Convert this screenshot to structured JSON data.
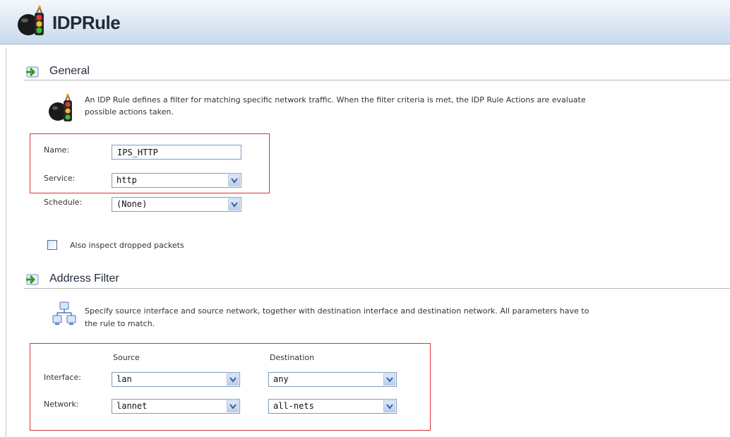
{
  "page_title": "IDPRule",
  "general": {
    "heading": "General",
    "description_line1": "An IDP Rule defines a filter for matching specific network traffic. When the filter criteria is met, the IDP Rule Actions are evaluate",
    "description_line2": "possible actions taken.",
    "name_label": "Name:",
    "name_value": "IPS_HTTP",
    "service_label": "Service:",
    "service_value": "http",
    "schedule_label": "Schedule:",
    "schedule_value": "(None)",
    "inspect_dropped_label": "Also inspect dropped packets",
    "inspect_dropped_checked": false
  },
  "address_filter": {
    "heading": "Address Filter",
    "description_line1": "Specify source interface and source network, together with destination interface and destination network. All parameters have to",
    "description_line2": "the rule to match.",
    "source_header": "Source",
    "destination_header": "Destination",
    "interface_label": "Interface:",
    "network_label": "Network:",
    "source_interface": "lan",
    "source_network": "lannet",
    "destination_interface": "any",
    "destination_network": "all-nets"
  },
  "icons": {
    "header": "traffic-light-bomb-icon",
    "section": "green-arrow-section-icon",
    "general_desc": "traffic-light-bomb-icon",
    "address_desc": "network-computers-icon",
    "dropdown": "chevron-down-icon"
  },
  "colors": {
    "header_gradient_top": "#f4f8fc",
    "header_gradient_bottom": "#c9dbee",
    "highlight_box": "#e0323a",
    "input_border": "#7f9db9"
  }
}
